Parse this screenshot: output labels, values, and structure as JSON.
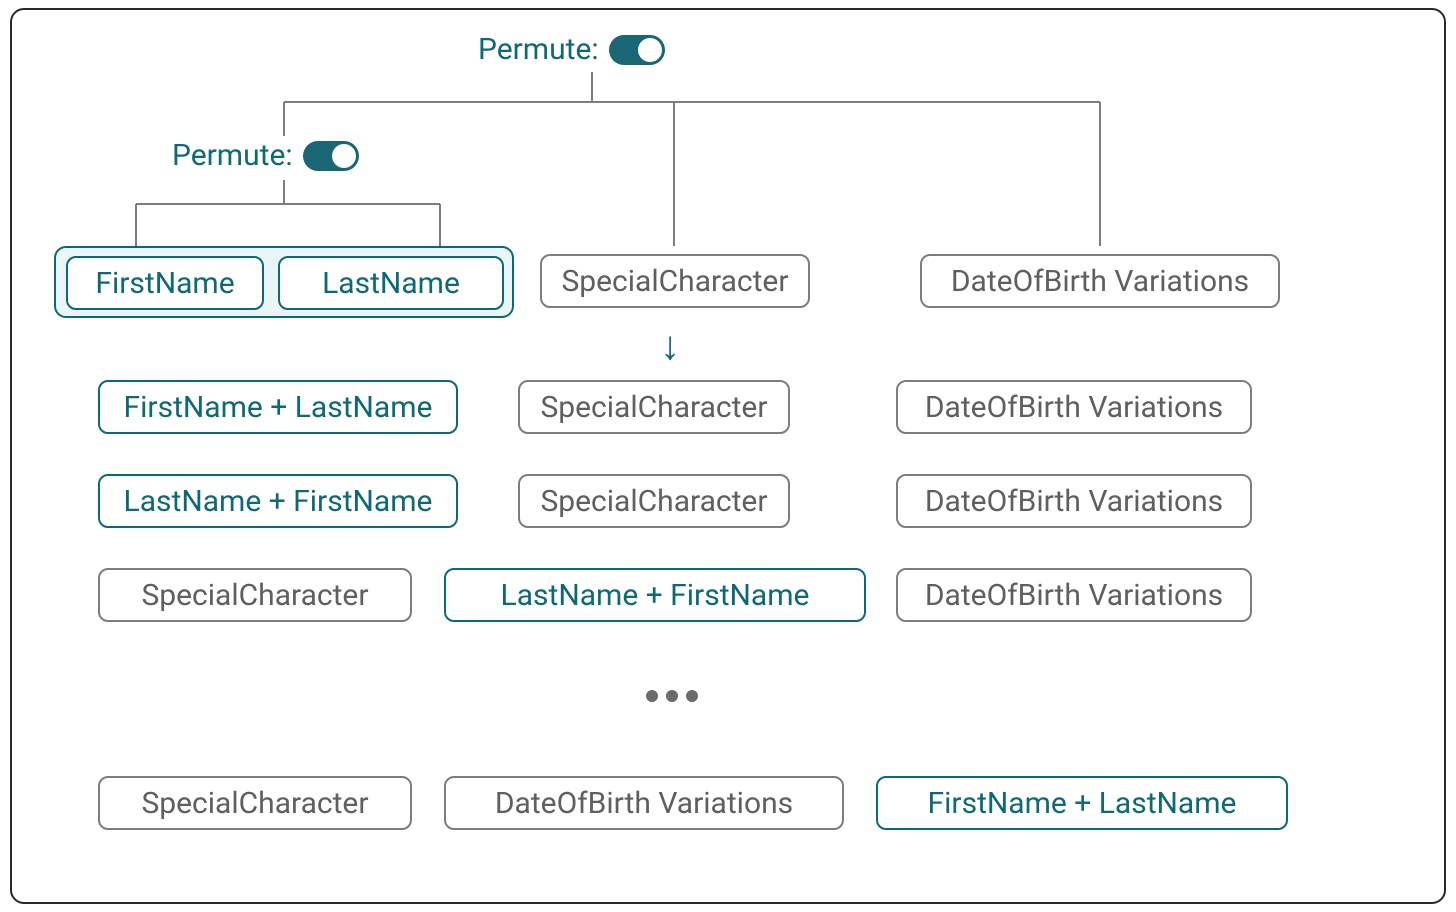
{
  "permuteTop": {
    "label": "Permute:"
  },
  "permuteLeft": {
    "label": "Permute:"
  },
  "tree": {
    "group": {
      "firstName": "FirstName",
      "lastName": "LastName"
    },
    "specialChar": "SpecialCharacter",
    "dobVar": "DateOfBirth Variations"
  },
  "rows": {
    "r1": {
      "a": "FirstName + LastName",
      "b": "SpecialCharacter",
      "c": "DateOfBirth Variations"
    },
    "r2": {
      "a": "LastName + FirstName",
      "b": "SpecialCharacter",
      "c": "DateOfBirth Variations"
    },
    "r3": {
      "a": "SpecialCharacter",
      "b": "LastName + FirstName",
      "c": "DateOfBirth Variations"
    },
    "r4": {
      "a": "SpecialCharacter",
      "b": "DateOfBirth Variations",
      "c": "FirstName + LastName"
    }
  },
  "colors": {
    "teal": "#0d6974",
    "gray": "#7d7d7d"
  }
}
